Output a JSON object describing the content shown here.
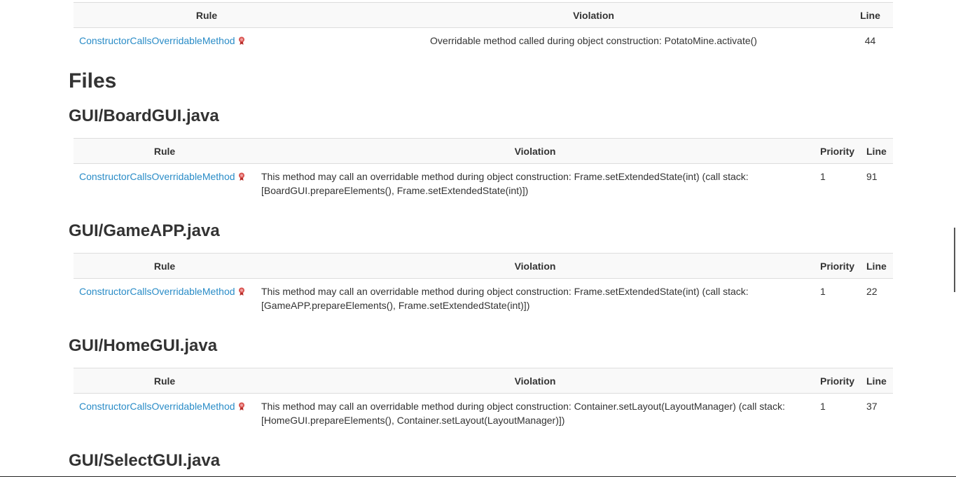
{
  "summary_table": {
    "headers": {
      "rule": "Rule",
      "violation": "Violation",
      "line": "Line"
    },
    "row": {
      "rule": "ConstructorCallsOverridableMethod",
      "violation": "Overridable method called during object construction: PotatoMine.activate()",
      "line": "44"
    }
  },
  "files_heading": "Files",
  "table_headers": {
    "rule": "Rule",
    "violation": "Violation",
    "priority": "Priority",
    "line": "Line"
  },
  "files": [
    {
      "name": "GUI/BoardGUI.java",
      "rule": "ConstructorCallsOverridableMethod",
      "violation": "This method may call an overridable method during object construction: Frame.setExtendedState(int) (call stack: [BoardGUI.prepareElements(), Frame.setExtendedState(int)])",
      "priority": "1",
      "line": "91"
    },
    {
      "name": "GUI/GameAPP.java",
      "rule": "ConstructorCallsOverridableMethod",
      "violation": "This method may call an overridable method during object construction: Frame.setExtendedState(int) (call stack: [GameAPP.prepareElements(), Frame.setExtendedState(int)])",
      "priority": "1",
      "line": "22"
    },
    {
      "name": "GUI/HomeGUI.java",
      "rule": "ConstructorCallsOverridableMethod",
      "violation": "This method may call an overridable method during object construction: Container.setLayout(LayoutManager) (call stack: [HomeGUI.prepareElements(), Container.setLayout(LayoutManager)])",
      "priority": "1",
      "line": "37"
    },
    {
      "name": "GUI/SelectGUI.java"
    }
  ],
  "icons": {
    "rule_icon": "external-doc-icon"
  },
  "colors": {
    "link": "#2a8cc7",
    "header_bg": "#f9f9f9",
    "icon": "#d9534f"
  }
}
